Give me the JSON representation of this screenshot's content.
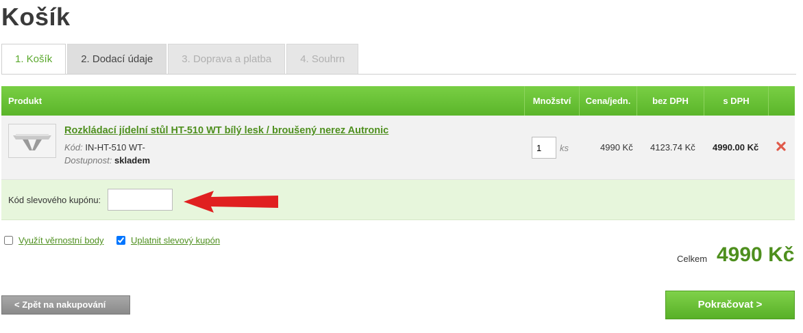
{
  "page": {
    "title": "Košík"
  },
  "tabs": [
    {
      "label": "1. Košík",
      "state": "active"
    },
    {
      "label": "2. Dodací údaje",
      "state": "done"
    },
    {
      "label": "3. Doprava a platba",
      "state": "disabled"
    },
    {
      "label": "4. Souhrn",
      "state": "disabled"
    }
  ],
  "table": {
    "headers": {
      "product": "Produkt",
      "quantity": "Množství",
      "unit_price": "Cena/jedn.",
      "price_without_vat": "bez DPH",
      "price_with_vat": "s DPH"
    },
    "items": [
      {
        "name": "Rozkládací jídelní stůl HT-510 WT bílý lesk / broušený nerez Autronic",
        "code_label": "Kód:",
        "code": "IN-HT-510 WT-",
        "availability_label": "Dostupnost:",
        "availability": "skladem",
        "quantity": "1",
        "quantity_unit": "ks",
        "unit_price": "4990 Kč",
        "price_without_vat": "4123.74 Kč",
        "price_with_vat": "4990.00 Kč",
        "remove_icon": "remove-x-icon"
      }
    ]
  },
  "coupon": {
    "label": "Kód slevového kupónu:",
    "value": ""
  },
  "options": {
    "loyalty_points": {
      "label": "Využít věrnostní body",
      "checked": false
    },
    "apply_coupon": {
      "label": "Uplatnit slevový kupón",
      "checked": true
    }
  },
  "total": {
    "label": "Celkem",
    "value": "4990 Kč"
  },
  "buttons": {
    "back": "<  Zpět na nakupování",
    "continue": "Pokračovat  >"
  },
  "colors": {
    "accent": "#5bb52a",
    "link": "#4e8f1e",
    "arrow": "#e02020",
    "remove": "#e05a4a"
  }
}
